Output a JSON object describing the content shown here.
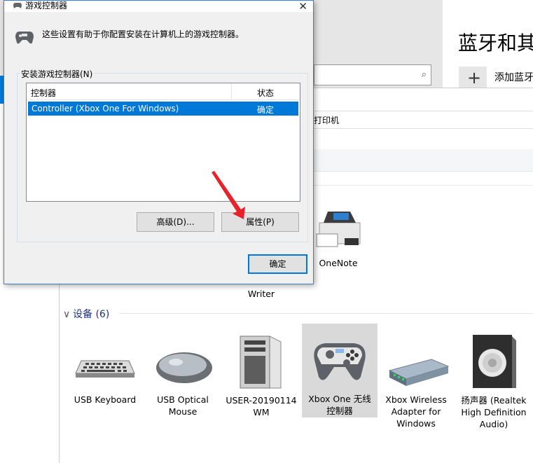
{
  "settings": {
    "title": "蓝牙和其",
    "add_label": "添加蓝牙",
    "search_icon": "search-icon"
  },
  "devices_window": {
    "address_text": "打印机",
    "printers": [
      {
        "label": "Writer"
      },
      {
        "label": "OneNote"
      }
    ],
    "group_header": "设备 (6)",
    "devices": [
      {
        "label": "USB Keyboard",
        "icon": "keyboard-icon"
      },
      {
        "label": "USB Optical Mouse",
        "icon": "mouse-icon"
      },
      {
        "label": "USER-20190114 WM",
        "icon": "computer-tower-icon"
      },
      {
        "label": "Xbox One 无线控制器",
        "icon": "gamepad-icon"
      },
      {
        "label": "Xbox Wireless Adapter for Windows",
        "icon": "wireless-adapter-icon"
      },
      {
        "label": "扬声器 (Realtek High Definition Audio)",
        "icon": "speaker-icon"
      }
    ]
  },
  "dialog": {
    "title": "游戏控制器",
    "description": "这些设置有助于你配置安装在计算机上的游戏控制器。",
    "group_label": "安装游戏控制器(N)",
    "columns": [
      "控制器",
      "状态"
    ],
    "rows": [
      {
        "name": "Controller (Xbox One For Windows)",
        "status": "确定"
      }
    ],
    "advanced_button": "高级(D)...",
    "properties_button": "属性(P)",
    "ok_button": "确定"
  },
  "colors": {
    "accent": "#0078d7",
    "arrow": "#e8222a"
  }
}
